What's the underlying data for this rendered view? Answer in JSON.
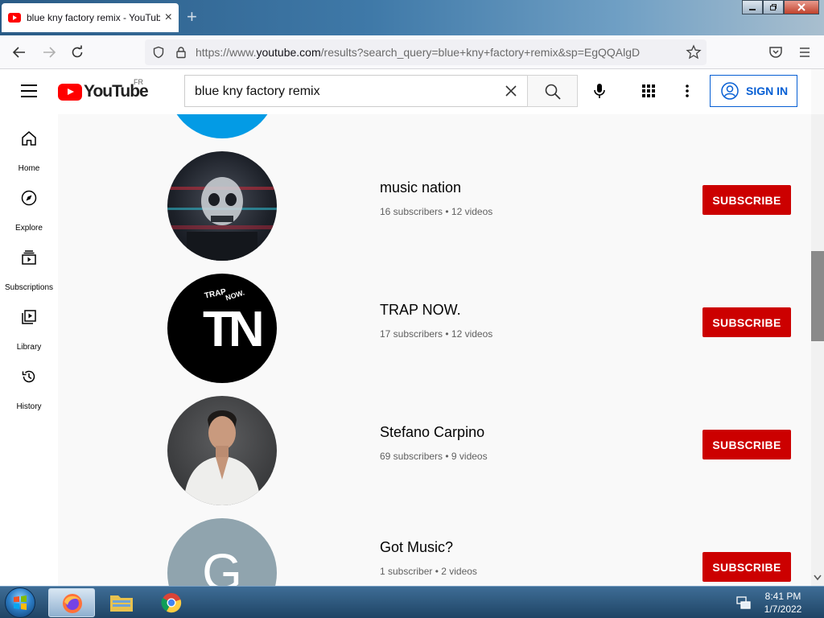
{
  "browser": {
    "tab_title": "blue kny factory remix - YouTube",
    "tab_close": "×",
    "new_tab": "+",
    "url_prefix": "https://www.",
    "url_domain": "youtube.com",
    "url_rest": "/results?search_query=blue+kny+factory+remix&sp=EgQQAlgD"
  },
  "youtube": {
    "logo_text": "YouTube",
    "country": "FR",
    "search_query": "blue kny factory remix",
    "sign_in": "SIGN IN"
  },
  "guide": [
    {
      "label": "Home",
      "icon": "home-icon"
    },
    {
      "label": "Explore",
      "icon": "compass-icon"
    },
    {
      "label": "Subscriptions",
      "icon": "subscriptions-icon"
    },
    {
      "label": "Library",
      "icon": "library-icon"
    },
    {
      "label": "History",
      "icon": "history-icon"
    }
  ],
  "channels": [
    {
      "name": "music nation",
      "meta": "16 subscribers • 12 videos",
      "subscribe": "SUBSCRIBE"
    },
    {
      "name": "TRAP NOW.",
      "meta": "17 subscribers • 12 videos",
      "subscribe": "SUBSCRIBE",
      "logo_top": "TRAP",
      "logo_now": "NOW.",
      "logo_letters": "TN"
    },
    {
      "name": "Stefano Carpino",
      "meta": "69 subscribers • 9 videos",
      "subscribe": "SUBSCRIBE"
    },
    {
      "name": "Got Music?",
      "meta": "1 subscriber • 2 videos",
      "subscribe": "SUBSCRIBE",
      "avatar_letter": "G"
    }
  ],
  "taskbar": {
    "time": "8:41 PM",
    "date": "1/7/2022"
  },
  "colors": {
    "youtube_red": "#ff0000",
    "subscribe_red": "#cc0000",
    "signin_blue": "#065fd4",
    "avatar_blue": "#039be5",
    "avatar_grey": "#90a4ae"
  }
}
